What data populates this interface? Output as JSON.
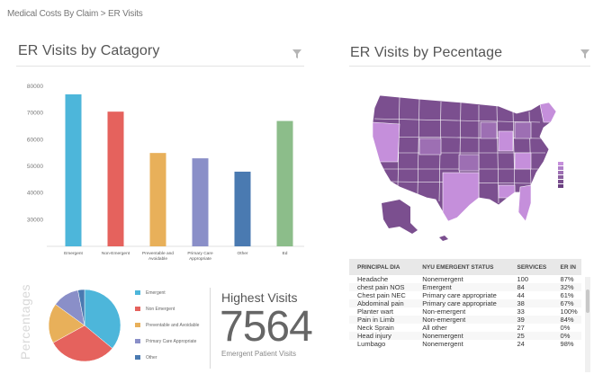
{
  "breadcrumb": {
    "parent": "Medical Costs By Claim",
    "separator": ">",
    "current": "ER Visits"
  },
  "left_card": {
    "title": "ER Visits by Catagory"
  },
  "right_card": {
    "title": "ER Visits by Pecentage"
  },
  "colors": {
    "emergent": "#4db6da",
    "non_emergent": "#e5625d",
    "preventable": "#e8b05a",
    "primary_care": "#8a8fc8",
    "other": "#4a7ab1",
    "ed": "#8cbd8a",
    "map_dark": "#7b4f8f",
    "map_mid": "#9d6fb3",
    "map_light": "#c58fdb"
  },
  "chart_data": [
    {
      "type": "bar",
      "categories": [
        "Emergent",
        "Non-Emergent",
        "Preventable and Avoidable",
        "Primary Care Appropriate",
        "Other",
        "Ed"
      ],
      "values": [
        77000,
        70500,
        55000,
        53000,
        48000,
        67000
      ],
      "ylim": [
        20000,
        80000
      ],
      "yticks": [
        30000,
        40000,
        50000,
        60000,
        70000,
        80000
      ],
      "grid": false
    },
    {
      "type": "pie",
      "title": "Percentages",
      "slices": [
        {
          "label": "Emergent",
          "value": 36
        },
        {
          "label": "Non Emergent",
          "value": 31
        },
        {
          "label": "Preventable and Avoidable",
          "value": 18
        },
        {
          "label": "Primary Care Appropriate",
          "value": 12
        },
        {
          "label": "Other",
          "value": 3
        }
      ]
    }
  ],
  "highest_visits": {
    "title": "Highest  Visits",
    "value": "7564",
    "subtitle": "Emergent Patient Visits"
  },
  "table": {
    "headers": [
      "PRINCIPAL DIA",
      "NYU EMERGENT STATUS",
      "SERVICES",
      "ER IN"
    ],
    "rows": [
      [
        "Headache",
        "Nonemergent",
        "100",
        "87%"
      ],
      [
        "chest pain NOS",
        "Emergent",
        "84",
        "32%"
      ],
      [
        "Chest pain NEC",
        "Primary care appropriate",
        "44",
        "61%"
      ],
      [
        "Abdominal pain",
        "Primary care appropriate",
        "38",
        "67%"
      ],
      [
        "Planter wart",
        "Non-emergent",
        "33",
        "100%"
      ],
      [
        "Pain in Limb",
        "Non-emergent",
        "39",
        "84%"
      ],
      [
        "Neck Sprain",
        "All other",
        "27",
        "0%"
      ],
      [
        "Head injury",
        "Nonemergent",
        "25",
        "0%"
      ],
      [
        "Lumbago",
        "Nonemergent",
        "24",
        "98%"
      ]
    ]
  }
}
